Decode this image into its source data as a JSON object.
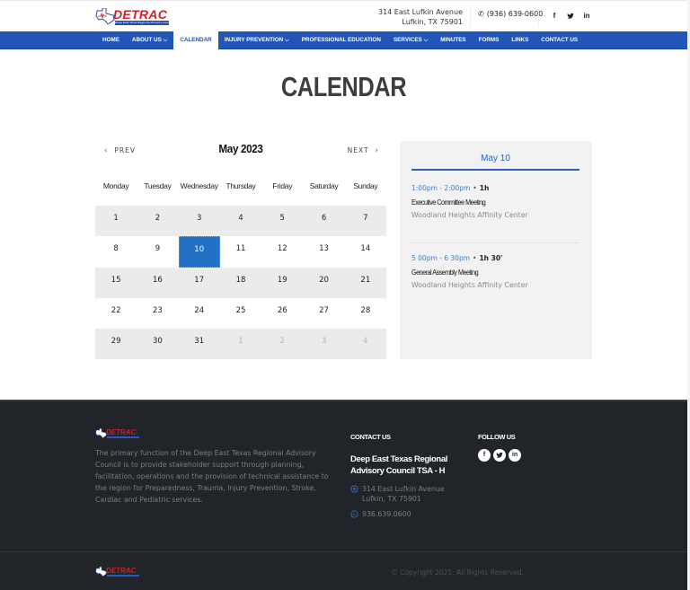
{
  "header": {
    "logo_text": "DETRAC",
    "logo_subtext": "Deep East Texas Regional Advisory Council",
    "address_line1": "314 East Lufkin Avenue",
    "address_line2": "Lufkin, TX 75901",
    "phone_icon": "phone-icon",
    "phone": "(936) 639-0600",
    "social": [
      {
        "icon": "facebook-icon",
        "glyph": "f"
      },
      {
        "icon": "twitter-icon",
        "glyph": "t"
      },
      {
        "icon": "linkedin-icon",
        "glyph": "in"
      }
    ]
  },
  "nav": {
    "items": [
      {
        "label": "HOME",
        "dropdown": false,
        "active": false
      },
      {
        "label": "ABOUT US",
        "dropdown": true,
        "active": false
      },
      {
        "label": "CALENDAR",
        "dropdown": false,
        "active": true
      },
      {
        "label": "INJURY PREVENTION",
        "dropdown": true,
        "active": false
      },
      {
        "label": "PROFESSIONAL EDUCATION",
        "dropdown": false,
        "active": false
      },
      {
        "label": "SERVICES",
        "dropdown": true,
        "active": false
      },
      {
        "label": "MINUTES",
        "dropdown": false,
        "active": false
      },
      {
        "label": "FORMS",
        "dropdown": false,
        "active": false
      },
      {
        "label": "LINKS",
        "dropdown": false,
        "active": false
      },
      {
        "label": "CONTACT US",
        "dropdown": false,
        "active": false
      }
    ],
    "chevron": "⌄"
  },
  "page": {
    "title": "CALENDAR"
  },
  "calendar": {
    "prev_label": "PREV",
    "next_label": "NEXT",
    "month_label": "May 2023",
    "weekdays": [
      "Monday",
      "Tuesday",
      "Wednesday",
      "Thursday",
      "Friday",
      "Saturday",
      "Sunday"
    ],
    "weeks": [
      [
        {
          "d": "1"
        },
        {
          "d": "2"
        },
        {
          "d": "3"
        },
        {
          "d": "4"
        },
        {
          "d": "5"
        },
        {
          "d": "6"
        },
        {
          "d": "7"
        }
      ],
      [
        {
          "d": "8"
        },
        {
          "d": "9"
        },
        {
          "d": "10",
          "selected": true
        },
        {
          "d": "11"
        },
        {
          "d": "12"
        },
        {
          "d": "13"
        },
        {
          "d": "14"
        }
      ],
      [
        {
          "d": "15"
        },
        {
          "d": "16"
        },
        {
          "d": "17"
        },
        {
          "d": "18"
        },
        {
          "d": "19"
        },
        {
          "d": "20"
        },
        {
          "d": "21"
        }
      ],
      [
        {
          "d": "22"
        },
        {
          "d": "23"
        },
        {
          "d": "24"
        },
        {
          "d": "25"
        },
        {
          "d": "26"
        },
        {
          "d": "27"
        },
        {
          "d": "28"
        }
      ],
      [
        {
          "d": "29"
        },
        {
          "d": "30"
        },
        {
          "d": "31"
        },
        {
          "d": "1",
          "other": true
        },
        {
          "d": "2",
          "other": true
        },
        {
          "d": "3",
          "other": true
        },
        {
          "d": "4",
          "other": true
        }
      ]
    ],
    "selected_color": "#2370c4"
  },
  "events": {
    "date_label": "May 10",
    "items": [
      {
        "time": "1:00pm - 2:00pm",
        "duration": "1h",
        "title": "Executive Committee Meeting",
        "location": "Woodland Heights Affinity Center"
      },
      {
        "time": "5 00pm - 6 30pm",
        "duration": "1h 30'",
        "title": "General Assembly Meeting",
        "location": "Woodland Heights Affinity Center"
      }
    ]
  },
  "footer": {
    "about": "The primary function of the Deep East Texas Regional Advisory Council is to provide stakeholder support through planning, facilitation, operations and the provision of technical assistance to the region for Preparedness, Trauma, Injury Prevention, Stroke, Cardiac and Pediatric services.",
    "contact_heading": "CONTACT US",
    "org_name": "Deep East Texas Regional Advisory Council TSA - H",
    "address_line1": "314 East Lufkin Avenue",
    "address_line2": "Lufkin, TX 75901",
    "phone": "936.639.0600",
    "follow_heading": "FOLLOW US",
    "social": [
      {
        "icon": "facebook-icon",
        "glyph": "f"
      },
      {
        "icon": "twitter-icon",
        "glyph": "t"
      },
      {
        "icon": "linkedin-icon",
        "glyph": "in"
      }
    ],
    "copyright": "© Copyright 2021. All Rights Reserved."
  },
  "colors": {
    "brand_blue": "#2155b8",
    "accent_blue": "#2370c4",
    "logo_red": "#d11f2b",
    "footer_bg": "#212429"
  }
}
